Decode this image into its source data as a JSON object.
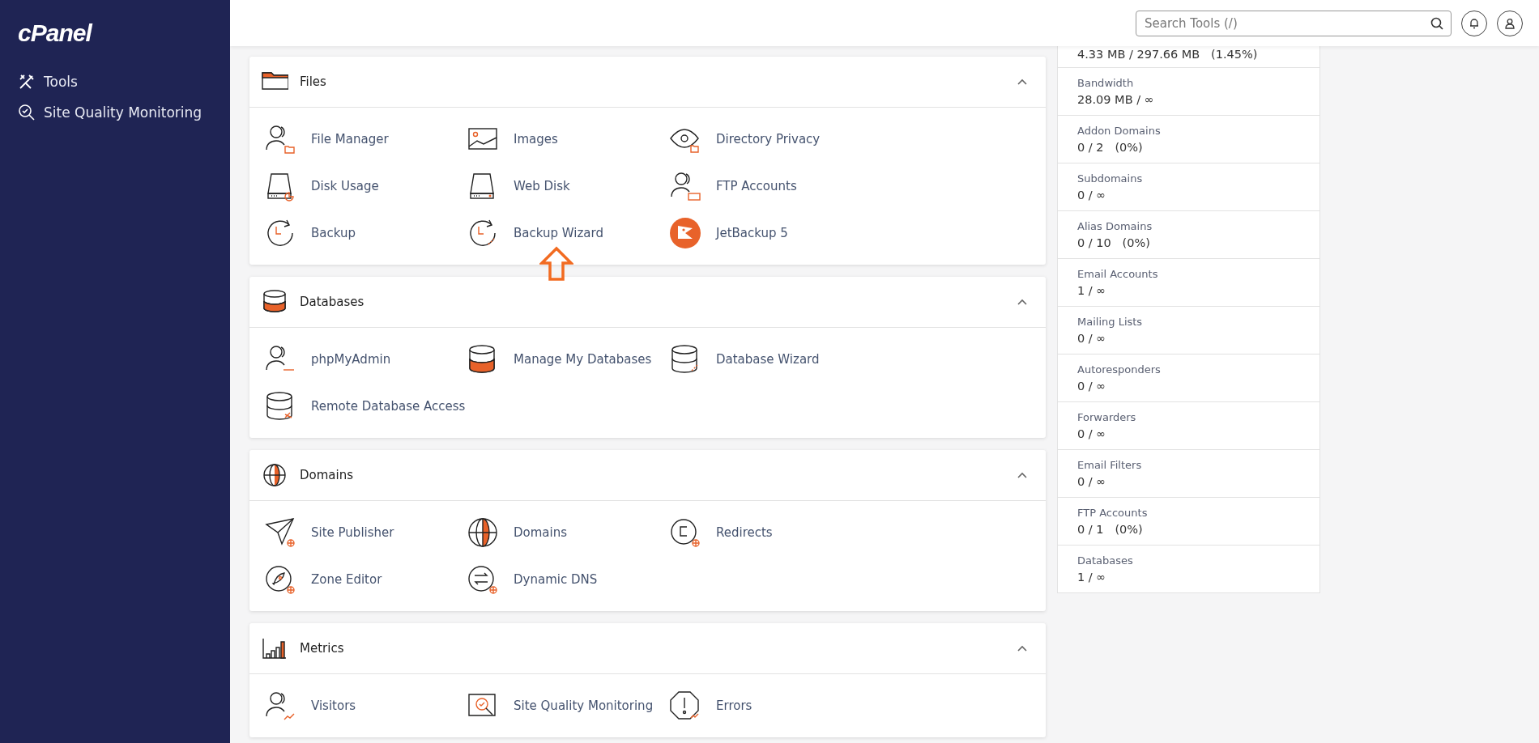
{
  "sidebar": {
    "logo": "cPanel",
    "items": [
      {
        "label": "Tools"
      },
      {
        "label": "Site Quality Monitoring"
      }
    ]
  },
  "header": {
    "search": {
      "placeholder": "Search Tools (/)"
    }
  },
  "sections": [
    {
      "title": "Files",
      "expanded": true,
      "items": [
        {
          "label": "File Manager",
          "highlighted": false
        },
        {
          "label": "Images",
          "highlighted": false
        },
        {
          "label": "Directory Privacy",
          "highlighted": false
        },
        {
          "label": "Disk Usage",
          "highlighted": false
        },
        {
          "label": "Web Disk",
          "highlighted": false
        },
        {
          "label": "FTP Accounts",
          "highlighted": false
        },
        {
          "label": "Backup",
          "highlighted": false
        },
        {
          "label": "Backup Wizard",
          "highlighted": true
        },
        {
          "label": "JetBackup 5",
          "highlighted": false
        }
      ]
    },
    {
      "title": "Databases",
      "expanded": true,
      "items": [
        {
          "label": "phpMyAdmin",
          "highlighted": false
        },
        {
          "label": "Manage My Databases",
          "highlighted": false
        },
        {
          "label": "Database Wizard",
          "highlighted": false
        },
        {
          "label": "Remote Database Access",
          "highlighted": false
        }
      ]
    },
    {
      "title": "Domains",
      "expanded": true,
      "items": [
        {
          "label": "Site Publisher",
          "highlighted": false
        },
        {
          "label": "Domains",
          "highlighted": false
        },
        {
          "label": "Redirects",
          "highlighted": false
        },
        {
          "label": "Zone Editor",
          "highlighted": false
        },
        {
          "label": "Dynamic DNS",
          "highlighted": false
        }
      ]
    },
    {
      "title": "Metrics",
      "expanded": true,
      "items": [
        {
          "label": "Visitors",
          "highlighted": false
        },
        {
          "label": "Site Quality Monitoring",
          "highlighted": false
        },
        {
          "label": "Errors",
          "highlighted": false
        }
      ]
    }
  ],
  "stats": [
    {
      "value": "4.33 MB / 297.66 MB   (1.45%)"
    },
    {
      "label": "Bandwidth",
      "value": "28.09 MB / ∞"
    },
    {
      "label": "Addon Domains",
      "value": "0 / 2   (0%)"
    },
    {
      "label": "Subdomains",
      "value": "0 / ∞"
    },
    {
      "label": "Alias Domains",
      "value": "0 / 10   (0%)"
    },
    {
      "label": "Email Accounts",
      "value": "1 / ∞"
    },
    {
      "label": "Mailing Lists",
      "value": "0 / ∞"
    },
    {
      "label": "Autoresponders",
      "value": "0 / ∞"
    },
    {
      "label": "Forwarders",
      "value": "0 / ∞"
    },
    {
      "label": "Email Filters",
      "value": "0 / ∞"
    },
    {
      "label": "FTP Accounts",
      "value": "0 / 1   (0%)"
    },
    {
      "label": "Databases",
      "value": "1 / ∞"
    }
  ]
}
